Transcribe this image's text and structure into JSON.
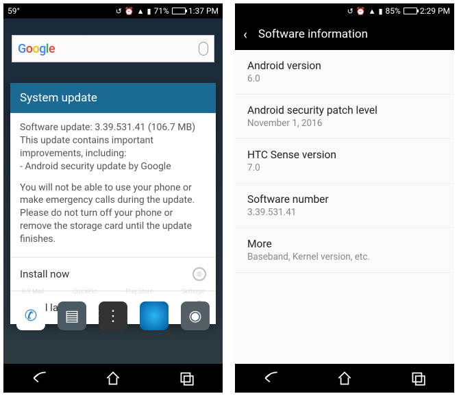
{
  "phone1": {
    "statusbar": {
      "temp": "59°",
      "battery_pct": "71%",
      "time": "1:37 PM"
    },
    "search": {
      "logo_text": "Google"
    },
    "dialog": {
      "title": "System update",
      "body1": "Software update: 3.39.531.41 (106.7 MB) This update contains important improvements, including:\n- Android security update by Google",
      "body2": "You will not be able to use your phone or make emergency calls during the update. Please do not turn off your phone or remove the storage card until the update finishes.",
      "option_now": "Install now",
      "option_later": "Install later"
    },
    "apps_row_labels": [
      "K-9 Mail",
      "QuickPic",
      "Play Store",
      "Settings"
    ]
  },
  "phone2": {
    "statusbar": {
      "battery_pct": "85%",
      "time": "2:29 PM"
    },
    "appbar_title": "Software information",
    "items": [
      {
        "title": "Android version",
        "sub": "6.0"
      },
      {
        "title": "Android security patch level",
        "sub": "November 1, 2016"
      },
      {
        "title": "HTC Sense version",
        "sub": "7.0"
      },
      {
        "title": "Software number",
        "sub": "3.39.531.41"
      },
      {
        "title": "More",
        "sub": "Baseband, Kernel version, etc."
      }
    ]
  }
}
